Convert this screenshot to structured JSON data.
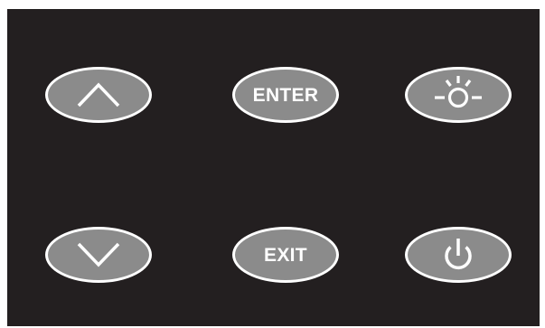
{
  "panel": {
    "background_color": "#231f20",
    "button_color": "#8b8b8b",
    "outline_color": "#ffffff"
  },
  "buttons": {
    "up": {
      "icon": "chevron-up-icon"
    },
    "enter": {
      "label": "ENTER"
    },
    "brightness": {
      "icon": "brightness-icon"
    },
    "down": {
      "icon": "chevron-down-icon"
    },
    "exit": {
      "label": "EXIT"
    },
    "power": {
      "icon": "power-icon"
    }
  }
}
